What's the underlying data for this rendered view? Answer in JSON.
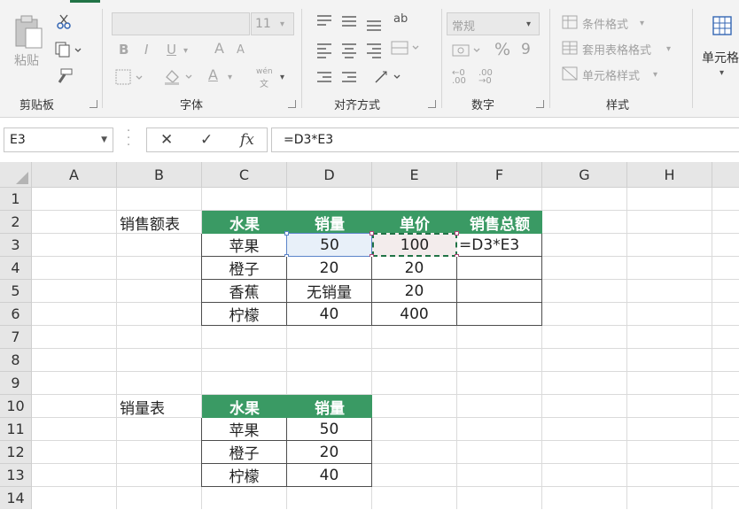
{
  "ribbon": {
    "clipboard": {
      "paste_label": "粘贴",
      "group_label": "剪贴板"
    },
    "font": {
      "size_value": "11",
      "group_label": "字体",
      "bold": "B",
      "italic": "I",
      "underline": "U",
      "grow": "A",
      "shrink": "A",
      "phonetic_top": "wén",
      "phonetic_bottom": "文"
    },
    "alignment": {
      "group_label": "对齐方式",
      "wrap_glyph": "ab"
    },
    "number": {
      "format_value": "常规",
      "percent": "%",
      "comma": "9",
      "group_label": "数字",
      "inc_decimal": "←0 .00",
      "dec_decimal": ".00 →0"
    },
    "styles": {
      "conditional": "条件格式",
      "table_format": "套用表格格式",
      "cell_styles": "单元格样式",
      "group_label": "样式"
    },
    "cells": {
      "label": "单元格"
    }
  },
  "formula_bar": {
    "name_box": "E3",
    "cancel": "✕",
    "enter": "✓",
    "fx": "fx",
    "formula": "=D3*E3"
  },
  "columns": [
    "A",
    "B",
    "C",
    "D",
    "E",
    "F",
    "G",
    "H"
  ],
  "rows": [
    "1",
    "2",
    "3",
    "4",
    "5",
    "6",
    "7",
    "8",
    "9",
    "10",
    "11",
    "12",
    "13",
    "14"
  ],
  "table1": {
    "title": "销售额表",
    "headers": [
      "水果",
      "销量",
      "单价",
      "销售总额"
    ],
    "rows": [
      [
        "苹果",
        "50",
        "100",
        "=D3*E3"
      ],
      [
        "橙子",
        "20",
        "20",
        ""
      ],
      [
        "香蕉",
        "无销量",
        "20",
        ""
      ],
      [
        "柠檬",
        "40",
        "400",
        ""
      ]
    ]
  },
  "table2": {
    "title": "销量表",
    "headers": [
      "水果",
      "销量"
    ],
    "rows": [
      [
        "苹果",
        "50"
      ],
      [
        "橙子",
        "20"
      ],
      [
        "柠檬",
        "40"
      ]
    ]
  },
  "colors": {
    "accent": "#217346",
    "table_header": "#3a9a64",
    "selection": "#5b84c9"
  }
}
